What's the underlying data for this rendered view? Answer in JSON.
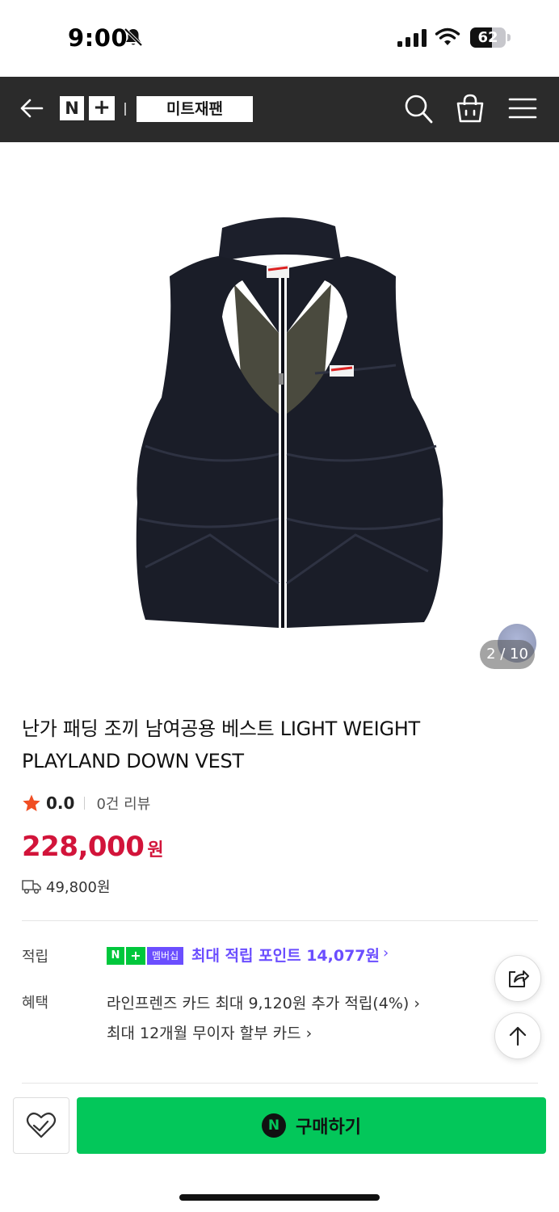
{
  "status_bar": {
    "time": "9:00",
    "battery_level": "62",
    "battery_fraction": 0.62
  },
  "header": {
    "logo_n": "N",
    "logo_plus": "+",
    "store_name": "미트재팬",
    "icons": [
      "back-arrow-icon",
      "search-icon",
      "shopping-bag-icon",
      "hamburger-menu-icon"
    ]
  },
  "gallery": {
    "counter": "2 / 10"
  },
  "product": {
    "title": "난가 패딩 조끼 남여공용 베스트 LIGHT WEIGHT PLAYLAND DOWN VEST",
    "rating": "0.0",
    "review_count": "0건 리뷰",
    "price": "228,000",
    "price_unit": "원",
    "shipping_fee": "49,800원"
  },
  "benefits": {
    "points_label": "적립",
    "membership_n": "N",
    "membership_plus": "+",
    "membership_text": "멤버십",
    "points_text": "최대 적립 포인트 14,077원",
    "benefit_label": "혜택",
    "card_benefit": "라인프렌즈 카드 최대 9,120원 추가 적립(4%)",
    "installment": "최대 12개월 무이자 할부 카드"
  },
  "bottom_bar": {
    "npay_symbol": "N",
    "buy_label": "구매하기"
  },
  "colors": {
    "header_bg": "#2b2b2b",
    "price": "#d2143a",
    "membership_purple": "#6b4eff",
    "buy_green": "#03c75a",
    "star": "#f04e23"
  }
}
